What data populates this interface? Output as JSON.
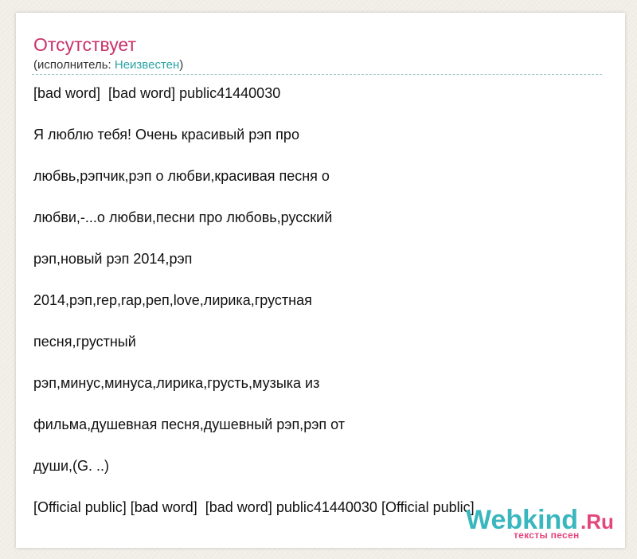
{
  "song": {
    "title": "Отсутствует",
    "artist_prefix": "(исполнитель: ",
    "artist_name": "Неизвестен",
    "artist_suffix": ")"
  },
  "lyrics": [
    "[bad word]  [bad word] public41440030",
    "Я люблю тебя! Очень красивый рэп про",
    "любвь,рэпчик,рэп о любви,красивая песня о",
    "любви,-...о любви,песни про любовь,русский",
    "рэп,новый рэп 2014,рэп",
    "2014,рэп,rep,rap,реп,love,лирика,грустная",
    "песня,грустный",
    "рэп,минус,минуса,лирика,грусть,музыка из",
    "фильма,душевная песня,душевный рэп,рэп от",
    "души,(G. ..)",
    "[Official public] [bad word]  [bad word] public41440030 [Official public]"
  ],
  "watermark": {
    "brand": "Webkind",
    "tld": ".Ru",
    "tagline": "тексты песен"
  },
  "colors": {
    "title": "#c8336a",
    "artist_link": "#2aa3a3",
    "watermark_brand": "#3ab7be",
    "watermark_accent": "#e3467c"
  }
}
